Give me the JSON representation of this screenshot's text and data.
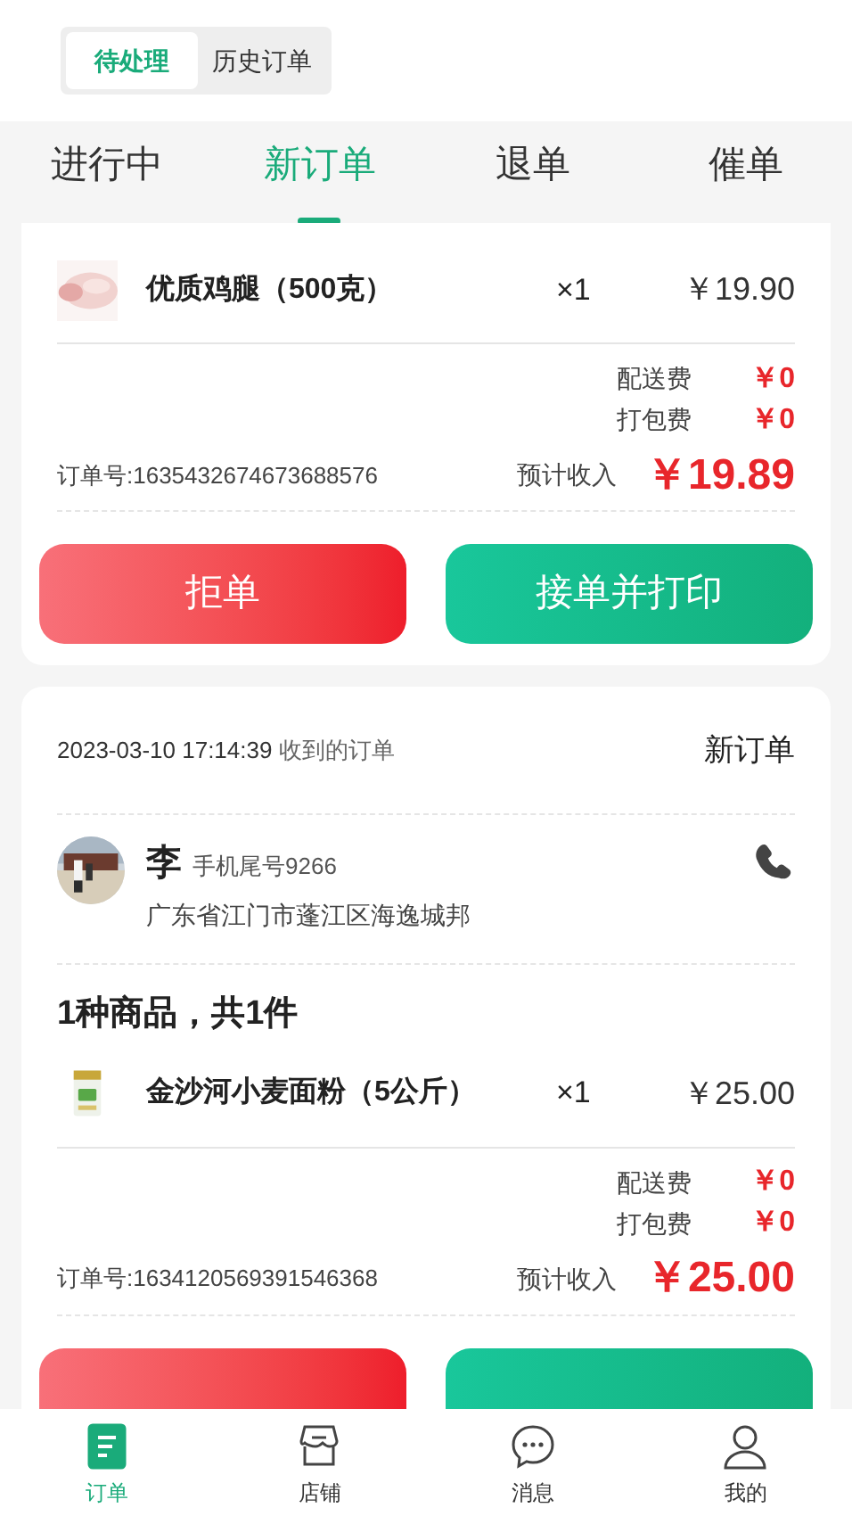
{
  "segment": [
    {
      "label": "待处理",
      "selected": true
    },
    {
      "label": "历史订单",
      "selected": false
    }
  ],
  "tabs": [
    {
      "label": "进行中",
      "selected": false
    },
    {
      "label": "新订单",
      "selected": true
    },
    {
      "label": "退单",
      "selected": false
    },
    {
      "label": "催单",
      "selected": false
    }
  ],
  "orders": [
    {
      "items": [
        {
          "kind": "picture",
          "name": "优质鸡腿（500克）",
          "qty": "×1",
          "price": "￥19.90"
        }
      ],
      "fees": [
        {
          "label": "配送费",
          "value": "￥0"
        },
        {
          "label": "打包费",
          "value": "￥0"
        }
      ],
      "order_no": "订单号:1635432674673688576",
      "income_label": "预计收入",
      "income": "￥19.89",
      "buttons": [
        {
          "label": "拒单",
          "kind": "reject"
        },
        {
          "label": "接单并打印",
          "kind": "accept"
        }
      ]
    },
    {
      "time": "2023-03-10 17:14:39",
      "time_suffix": "收到的订单",
      "status": "新订单",
      "customer": {
        "name": "李",
        "phone": "手机尾号9266",
        "address": "广东省江门市蓬江区海逸城邦"
      },
      "summary": "1种商品，共1件",
      "items": [
        {
          "kind": "picture",
          "name": "金沙河小麦面粉（5公斤）",
          "qty": "×1",
          "price": "￥25.00"
        }
      ],
      "fees": [
        {
          "label": "配送费",
          "value": "￥0"
        },
        {
          "label": "打包费",
          "value": "￥0"
        }
      ],
      "order_no": "订单号:1634120569391546368",
      "income_label": "预计收入",
      "income": "￥25.00",
      "buttons": [
        {
          "kind": "reject"
        },
        {
          "kind": "accept"
        }
      ]
    }
  ],
  "nav": [
    {
      "label": "订单",
      "kind": "orders",
      "selected": true
    },
    {
      "label": "店铺",
      "kind": "shop",
      "selected": false
    },
    {
      "label": "消息",
      "kind": "chat",
      "selected": false
    },
    {
      "label": "我的",
      "kind": "user",
      "selected": false
    }
  ]
}
